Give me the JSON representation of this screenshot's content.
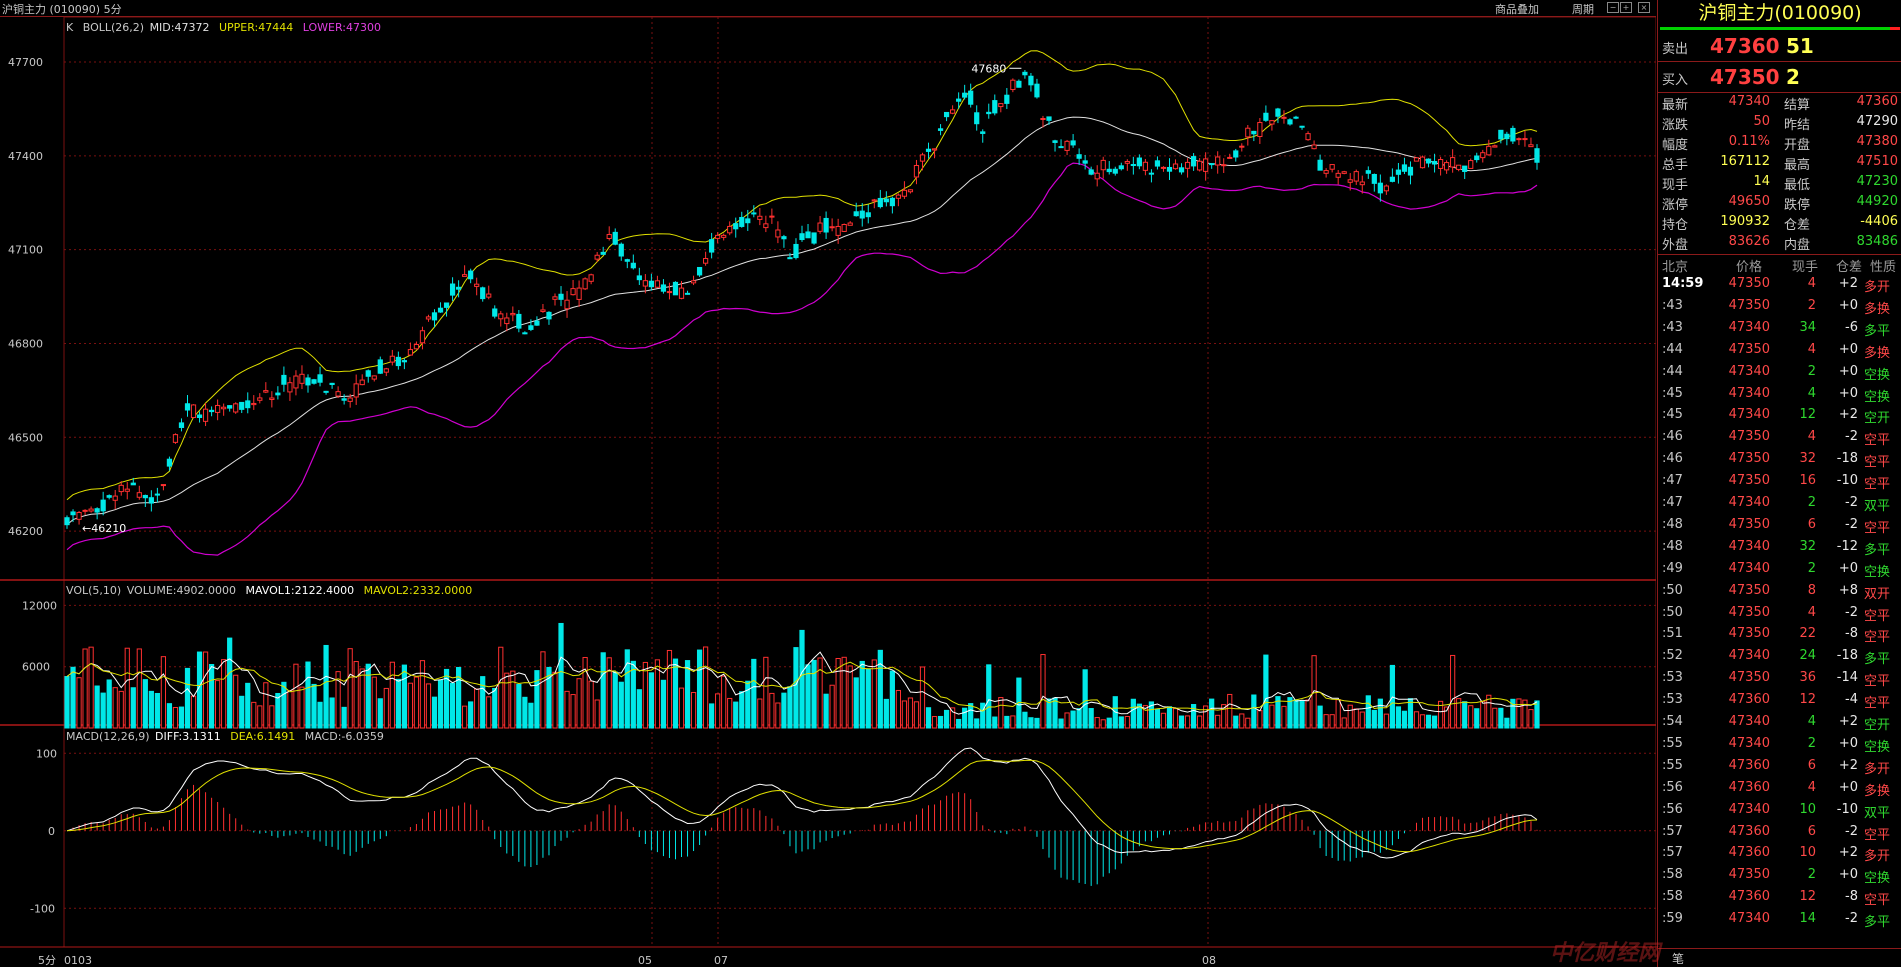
{
  "header": {
    "title": "沪铜主力 (010090) 5分",
    "overlay_link": "商品叠加",
    "period_link": "周期"
  },
  "kline": {
    "legend_prefix": "K",
    "boll_label": "BOLL(26,2)",
    "mid": "MID:47372",
    "upper": "UPPER:47444",
    "lower": "LOWER:47300",
    "y_ticks": [
      "47700",
      "47400",
      "47100",
      "46800",
      "46500",
      "46200"
    ],
    "high_marker": "47680",
    "low_marker": "46210"
  },
  "volume": {
    "legend": "VOL(5,10)",
    "volume": "VOLUME:4902.0000",
    "mavol1": "MAVOL1:2122.4000",
    "mavol2": "MAVOL2:2332.0000",
    "y_ticks": [
      "12000",
      "6000"
    ]
  },
  "macd": {
    "legend": "MACD(12,26,9)",
    "diff": "DIFF:3.1311",
    "dea": "DEA:6.1491",
    "macd": "MACD:-6.0359",
    "y_ticks": [
      "100",
      "0",
      "-100"
    ]
  },
  "xaxis": {
    "period": "5分",
    "labels": [
      {
        "text": "0103"
      },
      {
        "text": "05"
      },
      {
        "text": "07"
      },
      {
        "text": "08"
      }
    ]
  },
  "quote": {
    "title": "沪铜主力(010090)",
    "sell_label": "卖出",
    "sell_price": "47360",
    "sell_vol": "51",
    "buy_label": "买入",
    "buy_price": "47350",
    "buy_vol": "2",
    "rows": [
      {
        "l1": "最新",
        "v1": "47340",
        "c1": "red",
        "l2": "结算",
        "v2": "47360",
        "c2": "red"
      },
      {
        "l1": "涨跌",
        "v1": "50",
        "c1": "red",
        "l2": "昨结",
        "v2": "47290",
        "c2": "white"
      },
      {
        "l1": "幅度",
        "v1": "0.11%",
        "c1": "red",
        "l2": "开盘",
        "v2": "47380",
        "c2": "red"
      },
      {
        "l1": "总手",
        "v1": "167112",
        "c1": "yellow",
        "l2": "最高",
        "v2": "47510",
        "c2": "red"
      },
      {
        "l1": "现手",
        "v1": "14",
        "c1": "yellow",
        "l2": "最低",
        "v2": "47230",
        "c2": "green"
      },
      {
        "l1": "涨停",
        "v1": "49650",
        "c1": "red",
        "l2": "跌停",
        "v2": "44920",
        "c2": "green"
      },
      {
        "l1": "持仓",
        "v1": "190932",
        "c1": "yellow",
        "l2": "仓差",
        "v2": "-4406",
        "c2": "yellow"
      },
      {
        "l1": "外盘",
        "v1": "83626",
        "c1": "red",
        "l2": "内盘",
        "v2": "83486",
        "c2": "green"
      }
    ]
  },
  "ticks": {
    "headers": [
      "北京",
      "价格",
      "现手",
      "仓差",
      "性质"
    ],
    "rows": [
      {
        "time": "14:59",
        "price": "47350",
        "pc": "red",
        "vol": "4",
        "vc": "red",
        "chg": "+2",
        "nat": "多开",
        "nc": "red"
      },
      {
        "time": ":43",
        "price": "47350",
        "pc": "red",
        "vol": "2",
        "vc": "red",
        "chg": "+0",
        "nat": "多换",
        "nc": "red"
      },
      {
        "time": ":43",
        "price": "47340",
        "pc": "red",
        "vol": "34",
        "vc": "green",
        "chg": "-6",
        "nat": "多平",
        "nc": "green"
      },
      {
        "time": ":44",
        "price": "47350",
        "pc": "red",
        "vol": "4",
        "vc": "red",
        "chg": "+0",
        "nat": "多换",
        "nc": "red"
      },
      {
        "time": ":44",
        "price": "47340",
        "pc": "red",
        "vol": "2",
        "vc": "green",
        "chg": "+0",
        "nat": "空换",
        "nc": "green"
      },
      {
        "time": ":45",
        "price": "47340",
        "pc": "red",
        "vol": "4",
        "vc": "green",
        "chg": "+0",
        "nat": "空换",
        "nc": "green"
      },
      {
        "time": ":45",
        "price": "47340",
        "pc": "red",
        "vol": "12",
        "vc": "green",
        "chg": "+2",
        "nat": "空开",
        "nc": "green"
      },
      {
        "time": ":46",
        "price": "47350",
        "pc": "red",
        "vol": "4",
        "vc": "red",
        "chg": "-2",
        "nat": "空平",
        "nc": "red"
      },
      {
        "time": ":46",
        "price": "47350",
        "pc": "red",
        "vol": "32",
        "vc": "red",
        "chg": "-18",
        "nat": "空平",
        "nc": "red"
      },
      {
        "time": ":47",
        "price": "47350",
        "pc": "red",
        "vol": "16",
        "vc": "red",
        "chg": "-10",
        "nat": "空平",
        "nc": "red"
      },
      {
        "time": ":47",
        "price": "47340",
        "pc": "red",
        "vol": "2",
        "vc": "green",
        "chg": "-2",
        "nat": "双平",
        "nc": "green"
      },
      {
        "time": ":48",
        "price": "47350",
        "pc": "red",
        "vol": "6",
        "vc": "red",
        "chg": "-2",
        "nat": "空平",
        "nc": "red"
      },
      {
        "time": ":48",
        "price": "47340",
        "pc": "red",
        "vol": "32",
        "vc": "green",
        "chg": "-12",
        "nat": "多平",
        "nc": "green"
      },
      {
        "time": ":49",
        "price": "47340",
        "pc": "red",
        "vol": "2",
        "vc": "green",
        "chg": "+0",
        "nat": "空换",
        "nc": "green"
      },
      {
        "time": ":50",
        "price": "47350",
        "pc": "red",
        "vol": "8",
        "vc": "red",
        "chg": "+8",
        "nat": "双开",
        "nc": "red"
      },
      {
        "time": ":50",
        "price": "47350",
        "pc": "red",
        "vol": "4",
        "vc": "red",
        "chg": "-2",
        "nat": "空平",
        "nc": "red"
      },
      {
        "time": ":51",
        "price": "47350",
        "pc": "red",
        "vol": "22",
        "vc": "red",
        "chg": "-8",
        "nat": "空平",
        "nc": "red"
      },
      {
        "time": ":52",
        "price": "47340",
        "pc": "red",
        "vol": "24",
        "vc": "green",
        "chg": "-18",
        "nat": "多平",
        "nc": "green"
      },
      {
        "time": ":53",
        "price": "47350",
        "pc": "red",
        "vol": "36",
        "vc": "red",
        "chg": "-14",
        "nat": "空平",
        "nc": "red"
      },
      {
        "time": ":53",
        "price": "47360",
        "pc": "red",
        "vol": "12",
        "vc": "red",
        "chg": "-4",
        "nat": "空平",
        "nc": "red"
      },
      {
        "time": ":54",
        "price": "47340",
        "pc": "red",
        "vol": "4",
        "vc": "green",
        "chg": "+2",
        "nat": "空开",
        "nc": "green"
      },
      {
        "time": ":55",
        "price": "47340",
        "pc": "red",
        "vol": "2",
        "vc": "green",
        "chg": "+0",
        "nat": "空换",
        "nc": "green"
      },
      {
        "time": ":55",
        "price": "47360",
        "pc": "red",
        "vol": "6",
        "vc": "red",
        "chg": "+2",
        "nat": "多开",
        "nc": "red"
      },
      {
        "time": ":56",
        "price": "47360",
        "pc": "red",
        "vol": "4",
        "vc": "red",
        "chg": "+0",
        "nat": "多换",
        "nc": "red"
      },
      {
        "time": ":56",
        "price": "47340",
        "pc": "red",
        "vol": "10",
        "vc": "green",
        "chg": "-10",
        "nat": "双平",
        "nc": "green"
      },
      {
        "time": ":57",
        "price": "47360",
        "pc": "red",
        "vol": "6",
        "vc": "red",
        "chg": "-2",
        "nat": "空平",
        "nc": "red"
      },
      {
        "time": ":57",
        "price": "47360",
        "pc": "red",
        "vol": "10",
        "vc": "red",
        "chg": "+2",
        "nat": "多开",
        "nc": "red"
      },
      {
        "time": ":58",
        "price": "47350",
        "pc": "red",
        "vol": "2",
        "vc": "green",
        "chg": "+0",
        "nat": "空换",
        "nc": "green"
      },
      {
        "time": ":58",
        "price": "47360",
        "pc": "red",
        "vol": "12",
        "vc": "red",
        "chg": "-8",
        "nat": "空平",
        "nc": "red"
      },
      {
        "time": ":59",
        "price": "47340",
        "pc": "red",
        "vol": "14",
        "vc": "green",
        "chg": "-2",
        "nat": "多平",
        "nc": "green"
      }
    ]
  },
  "bottom_tab": "笔",
  "watermark": "中亿财经网",
  "colors": {
    "up": "#ff3030",
    "down": "#00e8e8",
    "mid_line": "#e0e0e0",
    "upper_line": "#e0e000",
    "lower_line": "#d000d0",
    "grid": "#7a1010",
    "mavol1": "#ffffff",
    "mavol2": "#e0e000"
  },
  "chart_data": {
    "type": "candlestick",
    "title": "沪铜主力 (010090) 5分",
    "ylim_price": [
      46050,
      47780
    ],
    "ylim_volume": [
      0,
      14000
    ],
    "ylim_macd": [
      -150,
      130
    ],
    "series": [
      {
        "name": "MID",
        "values": [
          47372
        ]
      },
      {
        "name": "UPPER",
        "values": [
          47444
        ]
      },
      {
        "name": "LOWER",
        "values": [
          47300
        ]
      }
    ],
    "key_points": {
      "high": 47680,
      "low": 46210,
      "last": 47340
    }
  }
}
